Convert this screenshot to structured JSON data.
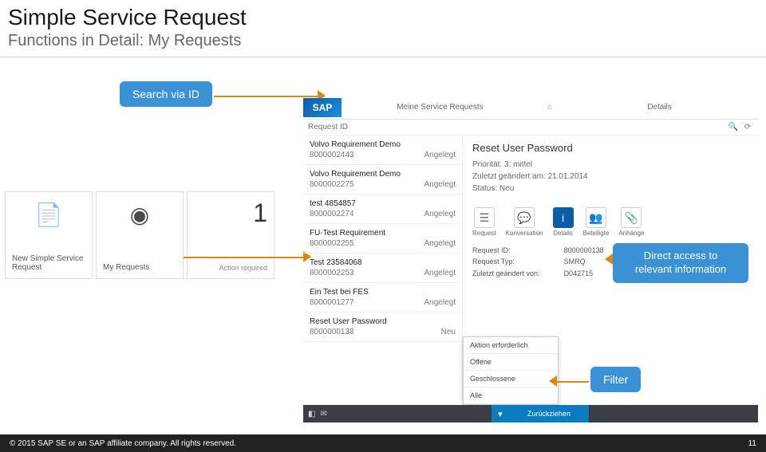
{
  "slide": {
    "title": "Simple Service Request",
    "subtitle": "Functions in Detail: My Requests"
  },
  "callouts": {
    "search": "Search via ID",
    "direct": "Direct access to relevant information",
    "filter": "Filter"
  },
  "tiles": {
    "new_label": "New Simple Service Request",
    "my_label": "My Requests",
    "my_count": "1",
    "my_sub": "Action required"
  },
  "app": {
    "logo": "SAP",
    "left_tab": "Meine Service Requests",
    "right_tab": "Details",
    "search_placeholder": "Request ID",
    "list": [
      {
        "title": "Volvo Requirement Demo",
        "id": "8000002443",
        "status": "Angelegt"
      },
      {
        "title": "Volvo Requirement Demo",
        "id": "8000002275",
        "status": "Angelegt"
      },
      {
        "title": "test 4854857",
        "id": "8000002274",
        "status": "Angelegt"
      },
      {
        "title": "FU-Test Requirement",
        "id": "8000002255",
        "status": "Angelegt"
      },
      {
        "title": "Test 23584068",
        "id": "8000002253",
        "status": "Angelegt"
      },
      {
        "title": "Ein Test bei FES",
        "id": "8000001277",
        "status": "Angelegt"
      },
      {
        "title": "Reset User Password",
        "id": "8000000138",
        "status": "Neu"
      }
    ],
    "detail": {
      "title": "Reset User Password",
      "priority_label": "Priorität:",
      "priority": "3: mittel",
      "changed_label": "Zuletzt geändert am:",
      "changed": "21.01.2014",
      "status_label": "Status:",
      "status": "Neu"
    },
    "iconrow": {
      "request": "Request",
      "konv": "Konversation",
      "details": "Details",
      "bet": "Beteiligte",
      "anh": "Anhänge"
    },
    "kv": {
      "k1": "Request ID:",
      "v1": "8000000138",
      "k2": "Request Typ:",
      "v2": "SMRQ",
      "k3": "Zuletzt geändert von:",
      "v3": "D042715"
    },
    "filter": {
      "o1": "Aktion erforderlich",
      "o2": "Offene",
      "o3": "Geschlossene",
      "o4": "Alle"
    },
    "withdraw": "Zurückziehen"
  },
  "footer": {
    "copyright": "© 2015 SAP SE or an SAP affiliate company. All rights reserved.",
    "page": "11"
  }
}
